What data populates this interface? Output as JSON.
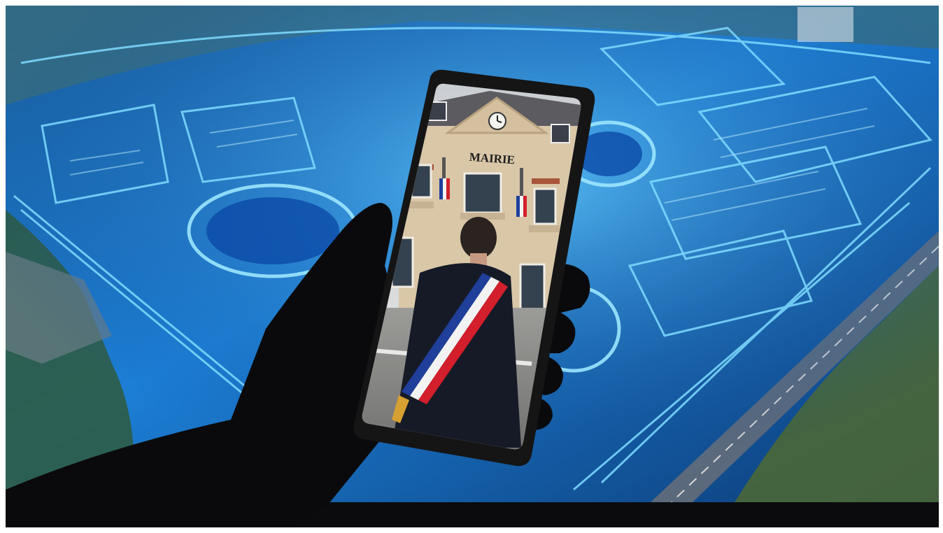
{
  "photo": {
    "building_sign": "MAIRIE",
    "colors": {
      "hologram_cyan": "#3fb8ff",
      "hologram_deep": "#0a3d8f",
      "sash_blue": "#1f3f9a",
      "sash_white": "#f2f2f2",
      "sash_red": "#d21f2b",
      "facade": "#d9c7a8",
      "silhouette": "#0a0a0c"
    }
  }
}
